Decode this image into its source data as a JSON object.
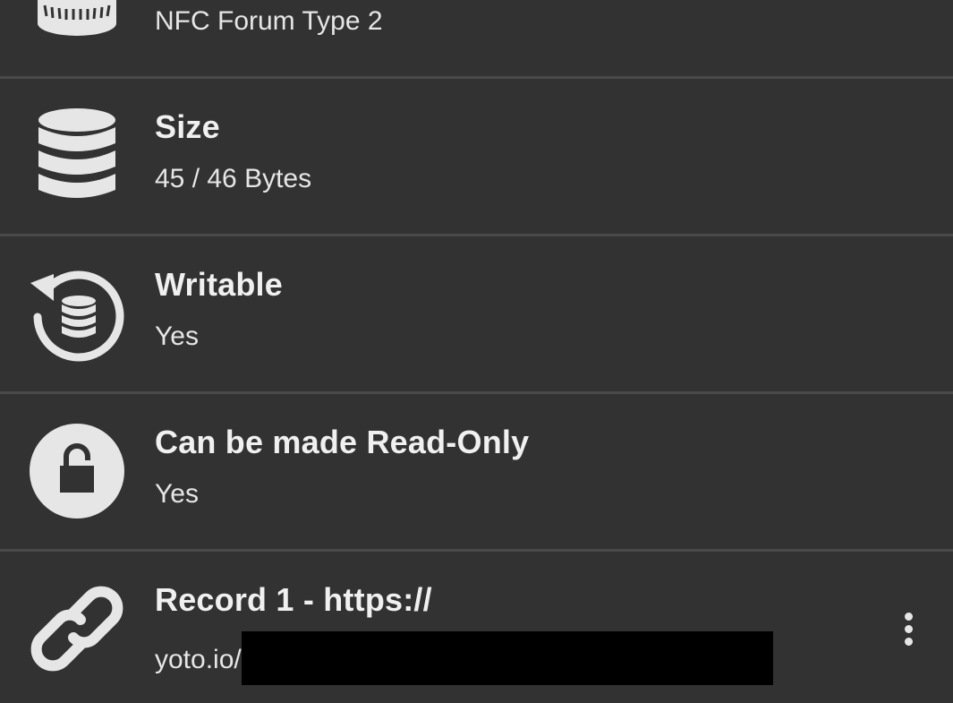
{
  "colors": {
    "background": "#323232",
    "divider": "#4a4a4a",
    "icon": "#e6e6e6",
    "text": "#f0f0f0"
  },
  "rows": [
    {
      "icon": "tag-type-icon",
      "title": "",
      "value": "NFC Forum Type 2"
    },
    {
      "icon": "database-icon",
      "title": "Size",
      "value": "45 / 46 Bytes"
    },
    {
      "icon": "writable-icon",
      "title": "Writable",
      "value": "Yes"
    },
    {
      "icon": "lock-icon",
      "title": "Can be made Read-Only",
      "value": "Yes"
    },
    {
      "icon": "link-icon",
      "title": "Record 1 - https://",
      "value": "yoto.io/",
      "menu_icon": "more-vert-icon"
    }
  ]
}
